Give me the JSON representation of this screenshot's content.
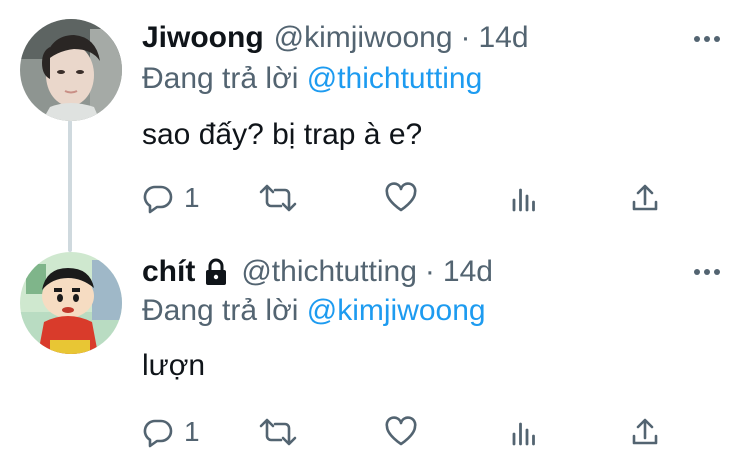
{
  "tweets": [
    {
      "name": "Jiwoong",
      "handle": "@kimjiwoong",
      "separator": "·",
      "time": "14d",
      "replying_prefix": "Đang trả lời",
      "replying_to": "@thichtutting",
      "text": "sao đấy? bị trap à e?",
      "reply_count": "1",
      "locked": false
    },
    {
      "name": "chít",
      "handle": "@thichtutting",
      "separator": "·",
      "time": "14d",
      "replying_prefix": "Đang trả lời",
      "replying_to": "@kimjiwoong",
      "text": "lượn",
      "reply_count": "1",
      "locked": true
    }
  ],
  "icons": {
    "reply": "reply-icon",
    "retweet": "retweet-icon",
    "like": "heart-icon",
    "analytics": "analytics-icon",
    "share": "share-icon",
    "more": "more-icon",
    "lock": "lock-icon"
  },
  "colors": {
    "text": "#0f1419",
    "secondary": "#536471",
    "link": "#1d9bf0",
    "thread_line": "#cfd9de"
  }
}
